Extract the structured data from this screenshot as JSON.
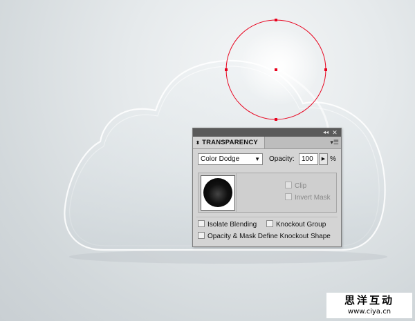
{
  "panel": {
    "tab_label": "TRANSPARENCY",
    "tab_arrows": "⬍",
    "collapse_icon": "◂◂",
    "close_icon": "✕",
    "menu_icon": "▾☰",
    "blend_mode": {
      "value": "Color Dodge",
      "arrow": "▼"
    },
    "opacity": {
      "label": "Opacity:",
      "value": "100",
      "stepper": "▶",
      "unit": "%"
    },
    "mask_options": {
      "clip": "Clip",
      "invert_mask": "Invert Mask"
    },
    "options": {
      "isolate_blending": "Isolate Blending",
      "knockout_group": "Knockout Group",
      "opacity_mask_knockout": "Opacity & Mask Define Knockout Shape"
    }
  },
  "watermark": {
    "chinese": "思洋互动",
    "url": "www.ciya.cn"
  },
  "colors": {
    "selection": "#e8001c",
    "panel_bg": "#d4d4d4",
    "titlebar": "#5a5a5a"
  }
}
